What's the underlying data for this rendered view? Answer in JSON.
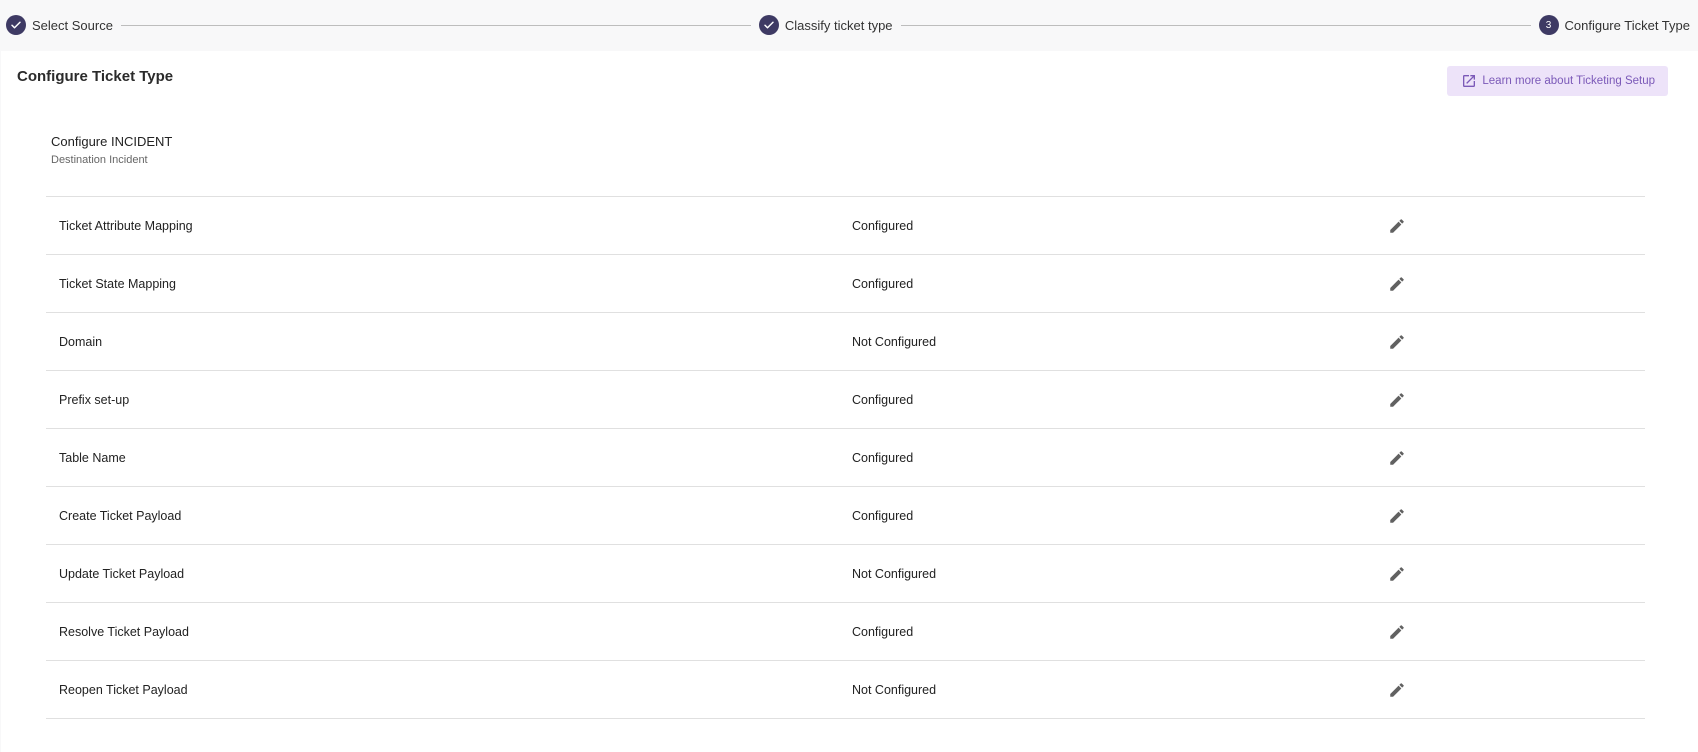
{
  "stepper": {
    "steps": [
      {
        "label": "Select Source",
        "state": "complete",
        "number": ""
      },
      {
        "label": "Classify ticket type",
        "state": "complete",
        "number": ""
      },
      {
        "label": "Configure Ticket Type",
        "state": "active",
        "number": "3"
      }
    ]
  },
  "page": {
    "title": "Configure Ticket Type",
    "learn_more_label": "Learn more about Ticketing Setup"
  },
  "section": {
    "title": "Configure INCIDENT",
    "subtitle": "Destination Incident"
  },
  "rows": [
    {
      "name": "Ticket Attribute Mapping",
      "status": "Configured"
    },
    {
      "name": "Ticket State Mapping",
      "status": "Configured"
    },
    {
      "name": "Domain",
      "status": "Not Configured"
    },
    {
      "name": "Prefix set-up",
      "status": "Configured"
    },
    {
      "name": "Table Name",
      "status": "Configured"
    },
    {
      "name": "Create Ticket Payload",
      "status": "Configured"
    },
    {
      "name": "Update Ticket Payload",
      "status": "Not Configured"
    },
    {
      "name": "Resolve Ticket Payload",
      "status": "Configured"
    },
    {
      "name": "Reopen Ticket Payload",
      "status": "Not Configured"
    }
  ],
  "colors": {
    "accent": "#3e3a64",
    "learn_bg": "#ede3f9",
    "learn_text": "#7b59b8",
    "icon": "#616161"
  },
  "icons": {
    "step_complete": "check-icon",
    "learn_more": "open-in-new-icon",
    "row_action": "pencil-icon"
  }
}
